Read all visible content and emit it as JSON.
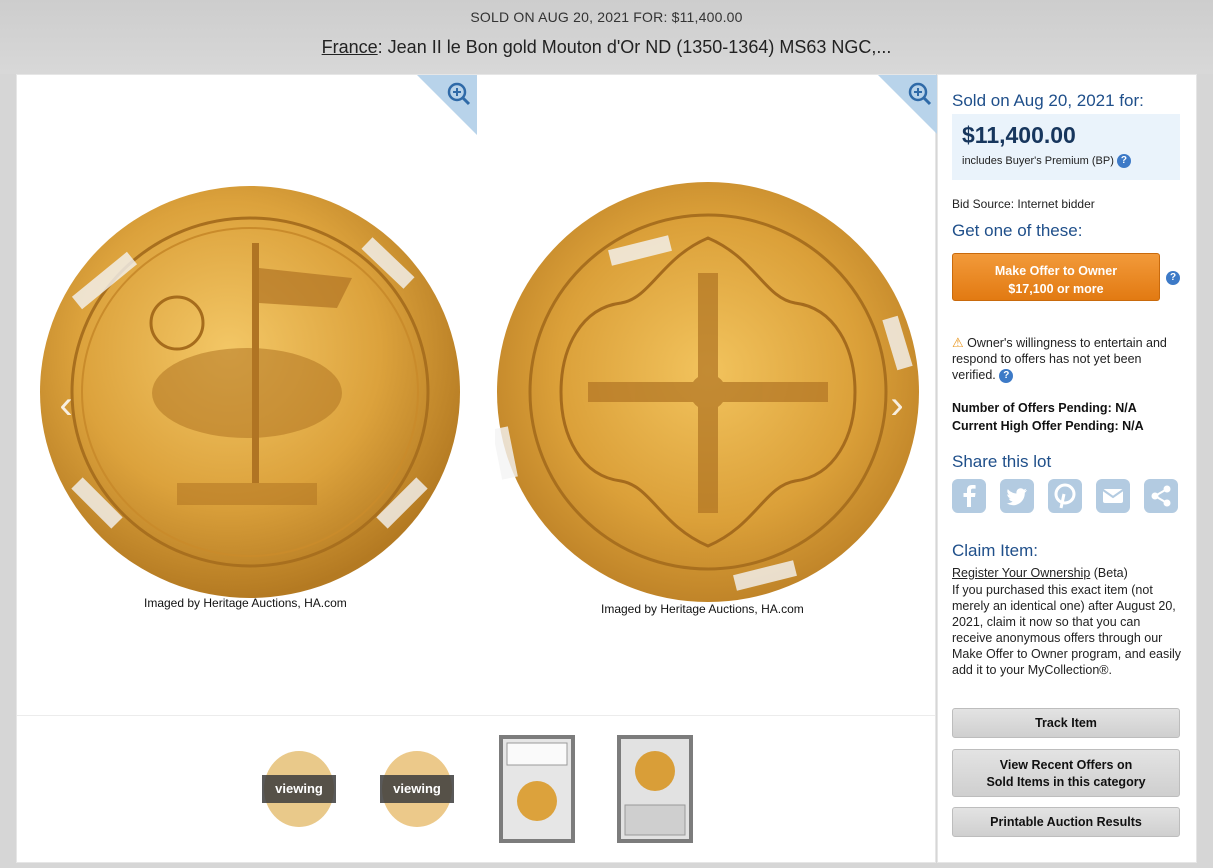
{
  "header": {
    "sold_line": "SOLD ON AUG 20, 2021 FOR: $11,400.00",
    "title_link": "France",
    "title_rest": ": Jean II le Bon gold Mouton d'Or ND (1350-1364) MS63 NGC,..."
  },
  "images": {
    "left_credit": "Imaged by Heritage Auctions, HA.com",
    "right_credit": "Imaged by Heritage Auctions, HA.com",
    "thumb_viewing_label": "viewing"
  },
  "sidebar": {
    "sold_label": "Sold on Aug 20, 2021 for:",
    "price": "$11,400.00",
    "bp_text": "includes Buyer's Premium (BP)",
    "help_glyph": "?",
    "bid_source": "Bid Source: Internet bidder",
    "get_one": "Get one of these:",
    "offer_line1": "Make Offer to Owner",
    "offer_line2": "$17,100 or more",
    "warning": "Owner's willingness to entertain and respond to offers has not yet been verified.",
    "offers_pending": "Number of Offers Pending: N/A",
    "high_offer": "Current High Offer Pending: N/A",
    "share_title": "Share this lot",
    "claim_title": "Claim Item:",
    "claim_link": "Register Your Ownership",
    "claim_beta": " (Beta)",
    "claim_text": "If you purchased this exact item (not merely an identical one) after August 20, 2021, claim it now so that you can receive anonymous offers through our Make Offer to Owner program, and easily add it to your MyCollection®.",
    "track_btn": "Track Item",
    "recent_line1": "View Recent Offers on",
    "recent_line2": "Sold Items in this category",
    "printable_btn": "Printable Auction Results"
  },
  "colors": {
    "accent_blue": "#1f4f8a",
    "offer_orange": "#e8871e",
    "gold": "#d9a23a"
  }
}
